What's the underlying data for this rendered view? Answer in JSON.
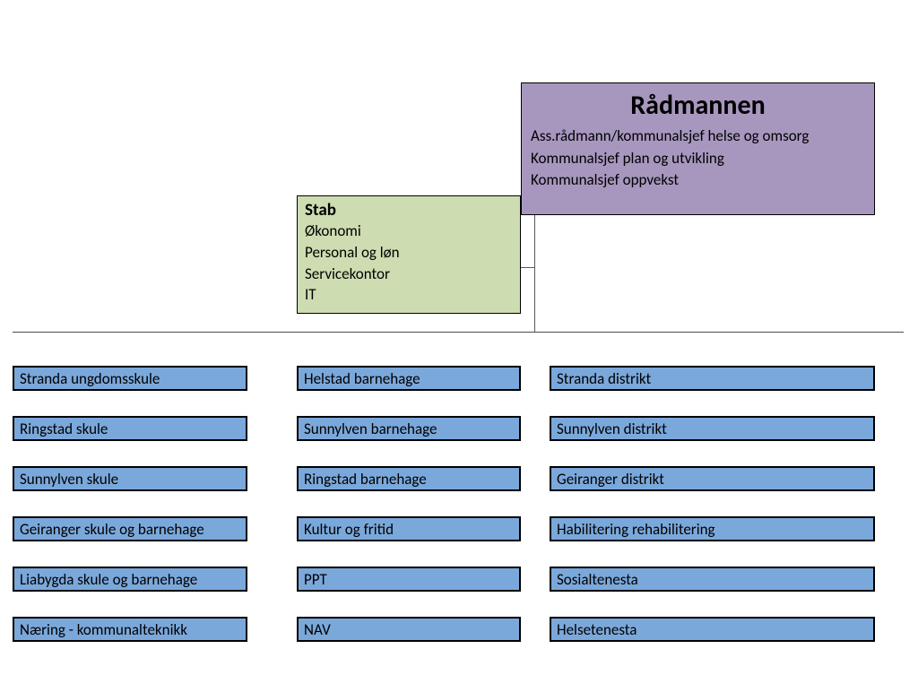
{
  "radmann": {
    "title": "Rådmannen",
    "lines": [
      "Ass.rådmann/kommunalsjef helse og omsorg",
      "Kommunalsjef plan og utvikling",
      "Kommunalsjef oppvekst"
    ]
  },
  "stab": {
    "title": "Stab",
    "lines": [
      "Økonomi",
      "Personal og løn",
      "Servicekontor",
      "IT"
    ]
  },
  "units": {
    "col1": [
      "Stranda ungdomsskule",
      "Ringstad skule",
      "Sunnylven skule",
      "Geiranger skule og barnehage",
      "Liabygda skule og barnehage",
      "Næring - kommunalteknikk"
    ],
    "col2": [
      "Helstad barnehage",
      "Sunnylven barnehage",
      "Ringstad barnehage",
      "Kultur og fritid",
      "PPT",
      "NAV"
    ],
    "col3": [
      "Stranda distrikt",
      "Sunnylven distrikt",
      "Geiranger distrikt",
      "Habilitering  rehabilitering",
      "Sosialtenesta",
      "Helsetenesta"
    ]
  }
}
